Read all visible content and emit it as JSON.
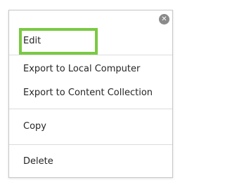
{
  "menu": {
    "close_icon": "close-circle-icon",
    "highlight_color": "#7ac943",
    "items": [
      {
        "label": "Edit"
      },
      {
        "label": "Export to Local Computer"
      },
      {
        "label": "Export to Content Collection"
      },
      {
        "label": "Copy"
      },
      {
        "label": "Delete"
      }
    ]
  }
}
